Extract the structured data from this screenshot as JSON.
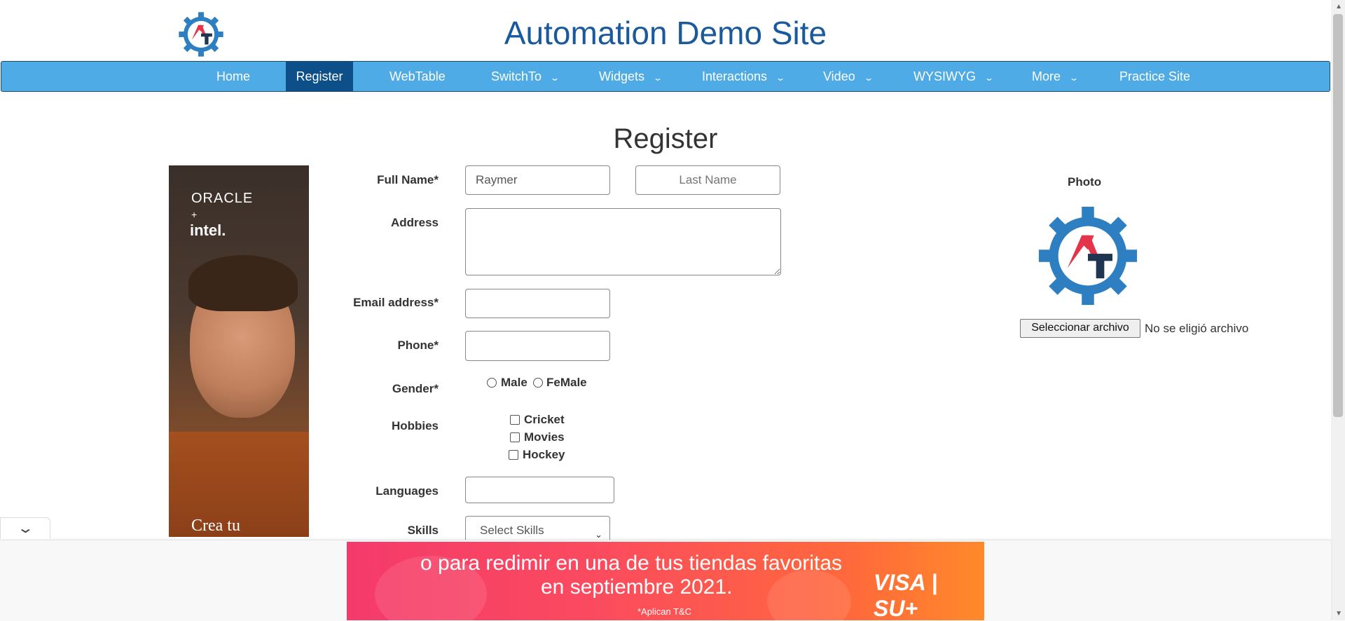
{
  "site_title": "Automation Demo Site",
  "nav": [
    {
      "label": "Home",
      "dropdown": false
    },
    {
      "label": "Register",
      "dropdown": false,
      "active": true
    },
    {
      "label": "WebTable",
      "dropdown": false
    },
    {
      "label": "SwitchTo",
      "dropdown": true
    },
    {
      "label": "Widgets",
      "dropdown": true
    },
    {
      "label": "Interactions",
      "dropdown": true
    },
    {
      "label": "Video",
      "dropdown": true
    },
    {
      "label": "WYSIWYG",
      "dropdown": true
    },
    {
      "label": "More",
      "dropdown": true
    },
    {
      "label": "Practice Site",
      "dropdown": false
    }
  ],
  "page_heading": "Register",
  "left_ad": {
    "brand1": "ORACLE",
    "plus": "+",
    "brand2": "intel.",
    "cta": "Crea tu"
  },
  "form": {
    "full_name_label": "Full Name*",
    "first_name_value": "Raymer",
    "last_name_placeholder": "Last Name",
    "address_label": "Address",
    "address_value": "",
    "email_label": "Email address*",
    "email_value": "",
    "phone_label": "Phone*",
    "phone_value": "",
    "gender_label": "Gender*",
    "gender_options": [
      "Male",
      "FeMale"
    ],
    "hobbies_label": "Hobbies",
    "hobbies_options": [
      "Cricket",
      "Movies",
      "Hockey"
    ],
    "languages_label": "Languages",
    "languages_value": "",
    "skills_label": "Skills",
    "skills_selected": "Select Skills"
  },
  "photo": {
    "label": "Photo",
    "file_button": "Seleccionar archivo",
    "file_status": "No se eligió archivo"
  },
  "bottom_ad": {
    "line1": "o para redimir en una de tus tiendas favoritas",
    "line2": "en septiembre 2021.",
    "brand": "VISA | SU+",
    "terms": "*Aplican T&C"
  },
  "colors": {
    "nav_bg": "#4fabe6",
    "nav_active": "#0d5089",
    "title": "#1a5a9c",
    "logo_blue": "#2d7fc1",
    "logo_red": "#e3344a",
    "logo_navy": "#1f3550"
  }
}
